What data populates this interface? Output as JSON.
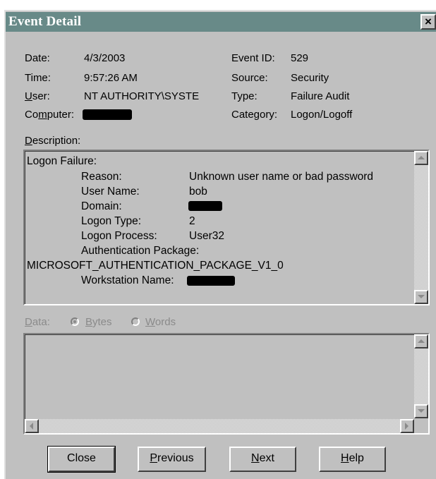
{
  "window": {
    "title": "Event Detail",
    "close_glyph": "×"
  },
  "fields": {
    "date_label": "Date:",
    "date_value": "4/3/2003",
    "time_label": "Time:",
    "time_value": "9:57:26 AM",
    "user_label": "User:",
    "user_value": "NT AUTHORITY\\SYSTE",
    "computer_label": "Computer:",
    "event_id_label": "Event ID:",
    "event_id_value": "529",
    "source_label": "Source:",
    "source_value": "Security",
    "type_label": "Type:",
    "type_value": "Failure Audit",
    "category_label": "Category:",
    "category_value": "Logon/Logoff"
  },
  "description": {
    "label": "Description:",
    "heading": "Logon Failure:",
    "reason_label": "Reason:",
    "reason_value": "Unknown user name or bad password",
    "user_name_label": "User Name:",
    "user_name_value": "bob",
    "domain_label": "Domain:",
    "logon_type_label": "Logon Type:",
    "logon_type_value": "2",
    "logon_process_label": "Logon Process:",
    "logon_process_value": "User32",
    "auth_package_label": "Authentication Package:",
    "auth_package_value": "MICROSOFT_AUTHENTICATION_PACKAGE_V1_0",
    "workstation_label": "Workstation Name:"
  },
  "data_section": {
    "label": "Data:",
    "bytes_label": "Bytes",
    "words_label": "Words",
    "selected": "Bytes"
  },
  "buttons": {
    "close": "Close",
    "previous": "Previous",
    "next": "Next",
    "help": "Help"
  },
  "icons": [
    "close-icon",
    "scroll-up-arrow-icon",
    "scroll-down-arrow-icon",
    "scroll-left-arrow-icon",
    "scroll-right-arrow-icon"
  ]
}
